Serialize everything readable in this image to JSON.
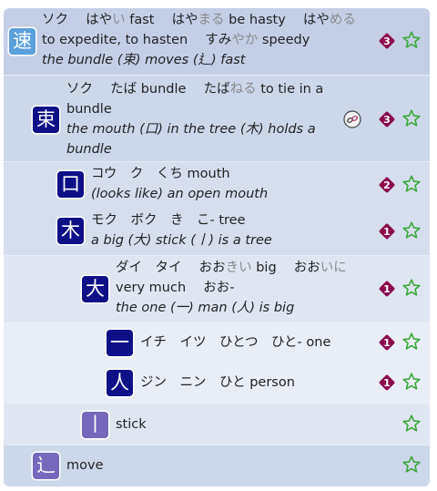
{
  "entries": [
    {
      "kanji": "速",
      "readings": {
        "on": "ソク",
        "r1_stem": "はや",
        "r1_ok": "い",
        "r1_gloss": "fast",
        "r2_stem": "はや",
        "r2_ok": "まる",
        "r2_gloss": "be hasty",
        "r3_stem": "はや",
        "r3_ok": "める",
        "r3_gloss": "to expedite, to hasten",
        "r4_stem": "すみ",
        "r4_ok": "やか",
        "r4_gloss": "speedy"
      },
      "meaning": "the bundle (束) moves (⻎) fast",
      "count": "3"
    },
    {
      "kanji": "束",
      "readings": {
        "on": "ソク",
        "r1": "たば",
        "r1_gloss": "bundle",
        "r2_stem": "たば",
        "r2_ok": "ねる",
        "r2_gloss": "to tie in a bundle"
      },
      "meaning": "the mouth (口) in the tree (木) holds a bundle",
      "count": "3",
      "extra_icon": "chain-link-icon"
    },
    {
      "kanji": "口",
      "readings": {
        "on": "コウ　ク　くち",
        "gloss": "mouth"
      },
      "meaning": "(looks like) an open mouth",
      "count": "2"
    },
    {
      "kanji": "木",
      "readings": {
        "on": "モク　ボク　き　こ-",
        "gloss": "tree"
      },
      "meaning": "a big (大) stick (丨) is a tree",
      "count": "1"
    },
    {
      "kanji": "大",
      "readings": {
        "on": "ダイ　タイ",
        "r1_stem": "おお",
        "r1_ok": "きい",
        "r1_gloss": "big",
        "r2_stem": "おお",
        "r2_ok": "いに",
        "r2_gloss": "very much",
        "r3": "おお-"
      },
      "meaning": "the one (一) man (人) is big",
      "count": "1"
    },
    {
      "kanji": "一",
      "readings": {
        "on": "イチ　イツ　ひとつ　ひと-",
        "gloss": "one"
      },
      "count": "1"
    },
    {
      "kanji": "人",
      "readings": {
        "on": "ジン　ニン　ひと",
        "gloss": "person"
      },
      "count": "1"
    },
    {
      "kanji": "丨",
      "readings": {
        "gloss": "stick"
      }
    },
    {
      "kanji": "⻌",
      "readings": {
        "gloss": "move"
      }
    }
  ],
  "colors": {
    "badge": "#8b0b4e",
    "star": "#3ba83b",
    "okurigana": "#8a8a8a",
    "kanji_light_blue": "#5aa0dc",
    "kanji_navy": "#0f0f88",
    "kanji_purple": "#7668bb"
  },
  "icons": {
    "badge": "diamond-badge",
    "star": "star-outline-icon",
    "extra": "chain-link-icon"
  }
}
